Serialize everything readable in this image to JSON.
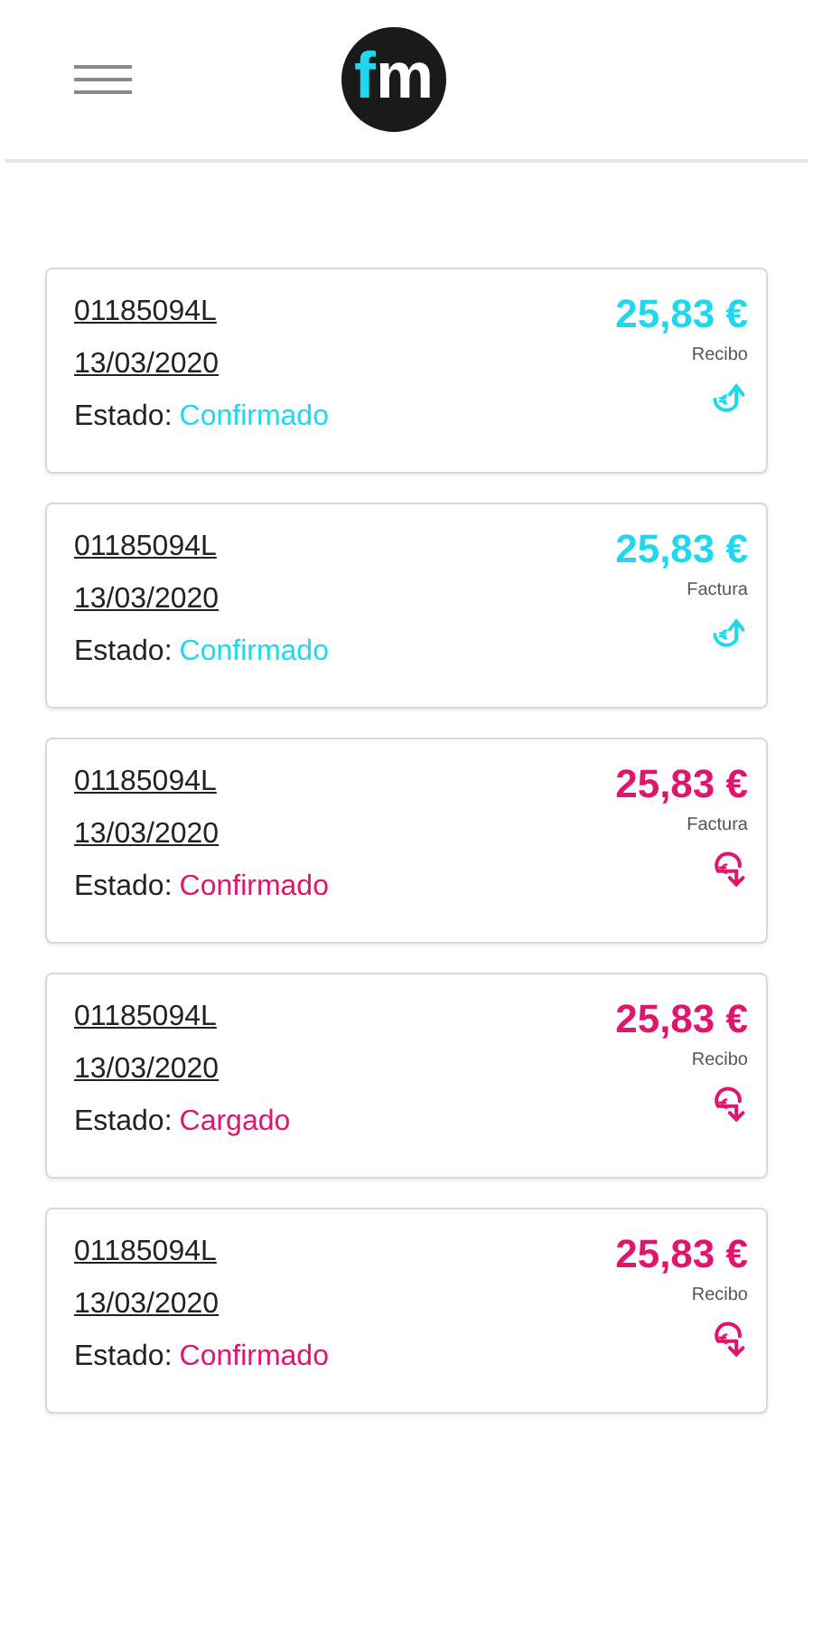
{
  "header": {
    "logo": [
      "f",
      "m"
    ]
  },
  "movements": [
    {
      "reference": "01185094L",
      "date": "13/03/2020",
      "status_label": "Estado:",
      "status": "Confirmado",
      "amount": "25,83 €",
      "type": "Recibo",
      "kind": "incoming"
    },
    {
      "reference": "01185094L",
      "date": "13/03/2020",
      "status_label": "Estado:",
      "status": "Confirmado",
      "amount": "25,83 €",
      "type": "Factura",
      "kind": "incoming"
    },
    {
      "reference": "01185094L",
      "date": "13/03/2020",
      "status_label": "Estado:",
      "status": "Confirmado",
      "amount": "25,83 €",
      "type": "Factura",
      "kind": "outgoing"
    },
    {
      "reference": "01185094L",
      "date": "13/03/2020",
      "status_label": "Estado:",
      "status": "Cargado",
      "amount": "25,83 €",
      "type": "Recibo",
      "kind": "outgoing"
    },
    {
      "reference": "01185094L",
      "date": "13/03/2020",
      "status_label": "Estado:",
      "status": "Confirmado",
      "amount": "25,83 €",
      "type": "Recibo",
      "kind": "outgoing"
    }
  ]
}
